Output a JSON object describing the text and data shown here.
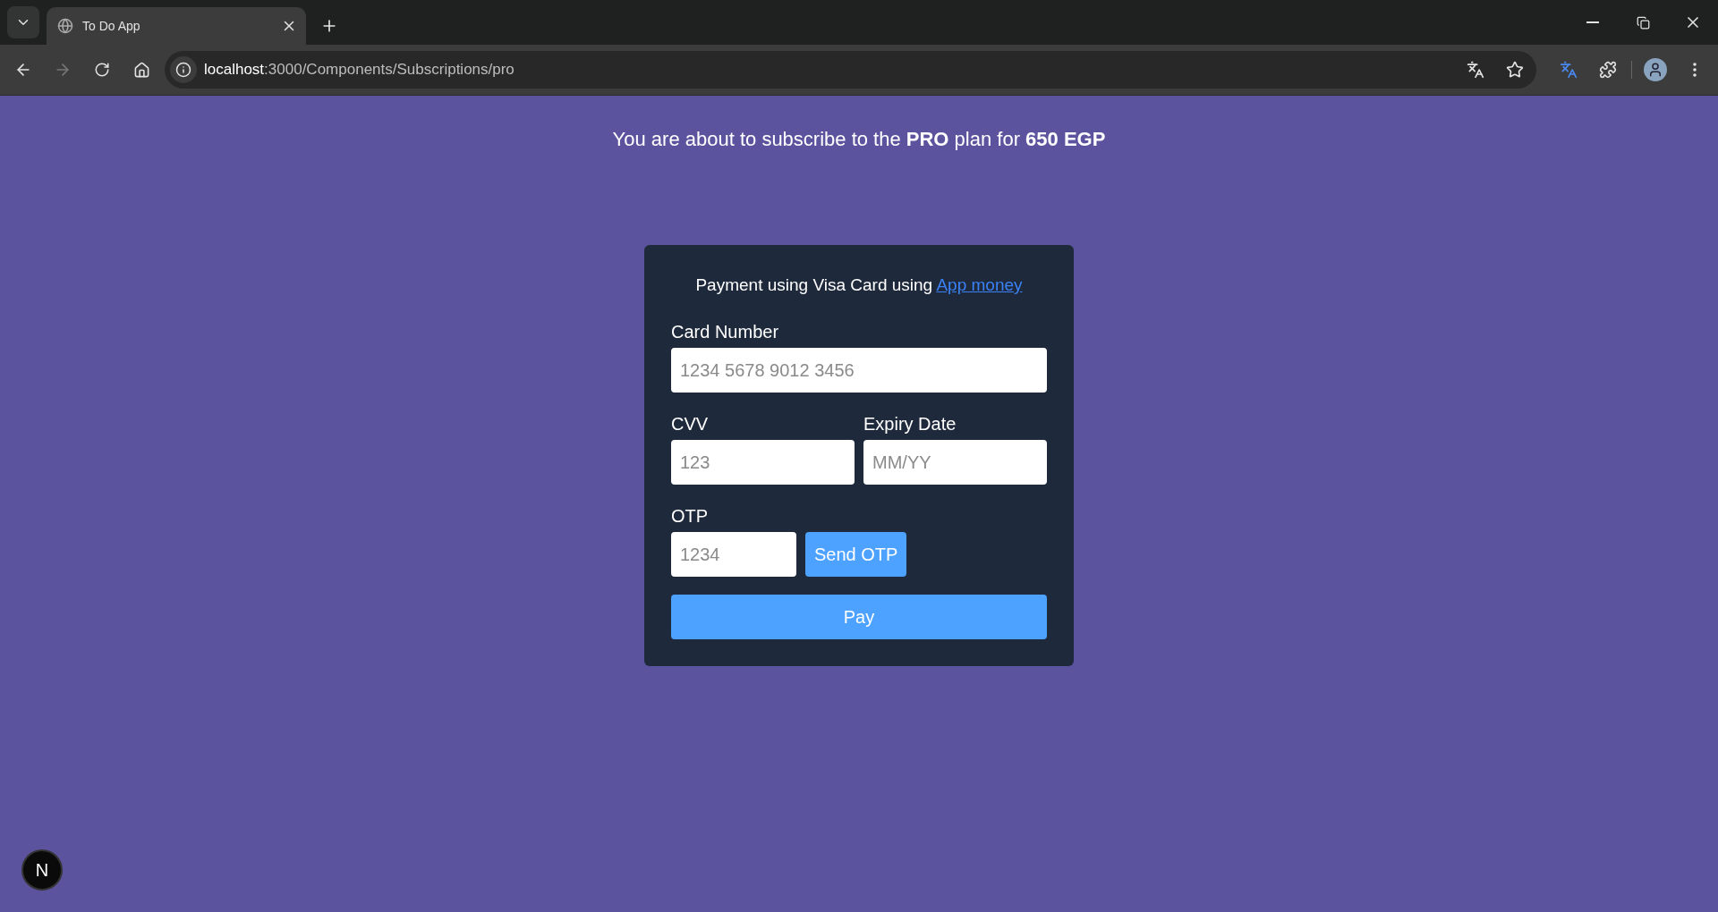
{
  "browser": {
    "tabs": [
      {
        "title": "To Do App",
        "selected": true
      }
    ],
    "nav": {
      "back_disabled": false,
      "forward_disabled": true
    },
    "address": {
      "host": "localhost",
      "path": ":3000/Components/Subscriptions/pro"
    }
  },
  "page": {
    "headline": "You are about to subscribe to the **PRO** plan for **650 EGP**",
    "card": {
      "title": "Payment using Visa Card using",
      "link": "App money",
      "fields": [
        {
          "label": "Card Number",
          "placeholder": "1234 5678 9012 3456"
        },
        {
          "label": "CVV",
          "placeholder": "123"
        },
        {
          "label": "Expiry Date",
          "placeholder": "MM/YY"
        },
        {
          "label": "OTP",
          "placeholder": "1234"
        }
      ],
      "send_button": "Send OTP",
      "pay_button": "Pay"
    },
    "dev_badge": "N"
  }
}
